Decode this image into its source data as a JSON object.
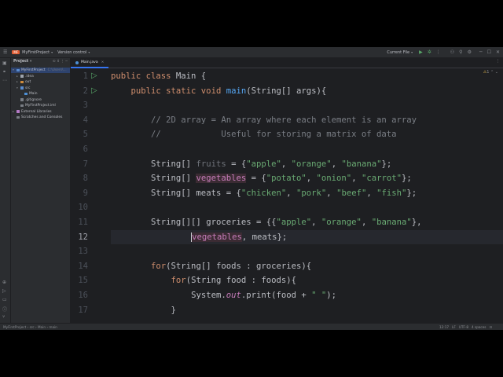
{
  "titlebar": {
    "project_badge": "MF",
    "project_name": "MyFirstProject",
    "vcs_label": "Version control",
    "run_config": "Current File"
  },
  "project_panel": {
    "title": "Project",
    "tree": [
      {
        "label": "MyFirstProject",
        "hint": "C:\\Users\\...",
        "level": 0,
        "icon": "folder-blue",
        "arrow": "▾"
      },
      {
        "label": ".idea",
        "level": 1,
        "icon": "folder",
        "arrow": "▸"
      },
      {
        "label": "out",
        "level": 1,
        "icon": "folder-orange",
        "arrow": "▸"
      },
      {
        "label": "src",
        "level": 1,
        "icon": "folder-blue",
        "arrow": "▾"
      },
      {
        "label": "Main",
        "level": 2,
        "icon": "java-file",
        "arrow": ""
      },
      {
        "label": ".gitignore",
        "level": 1,
        "icon": "file",
        "arrow": ""
      },
      {
        "label": "MyFirstProject.iml",
        "level": 1,
        "icon": "file",
        "arrow": ""
      },
      {
        "label": "External Libraries",
        "level": 0,
        "icon": "library",
        "arrow": "▸"
      },
      {
        "label": "Scratches and Consoles",
        "level": 0,
        "icon": "scratch",
        "arrow": ""
      }
    ]
  },
  "editor": {
    "tab_label": "Main.java",
    "warning_count": "1",
    "current_line": 12,
    "line_numbers": [
      "1",
      "2",
      "3",
      "4",
      "5",
      "6",
      "7",
      "8",
      "9",
      "10",
      "11",
      "12",
      "13",
      "14",
      "15",
      "16",
      "17"
    ],
    "code": {
      "l1_a": "public class ",
      "l1_b": "Main {",
      "l2_a": "public static void ",
      "l2_b": "main",
      "l2_c": "(String[] args){",
      "l4": "// 2D array = An array where each element is an array",
      "l5": "//            Useful for storing a matrix of data",
      "l7_a": "String[] ",
      "l7_b": "fruits",
      "l7_c": " = {",
      "l7_d": "\"apple\"",
      "l7_e": ", ",
      "l7_f": "\"orange\"",
      "l7_g": ", ",
      "l7_h": "\"banana\"",
      "l7_i": "};",
      "l8_a": "String[] ",
      "l8_b": "vegetables",
      "l8_c": " = {",
      "l8_d": "\"potato\"",
      "l8_e": ", ",
      "l8_f": "\"onion\"",
      "l8_g": ", ",
      "l8_h": "\"carrot\"",
      "l8_i": "};",
      "l9_a": "String[] meats = {",
      "l9_b": "\"chicken\"",
      "l9_c": ", ",
      "l9_d": "\"pork\"",
      "l9_e": ", ",
      "l9_f": "\"beef\"",
      "l9_g": ", ",
      "l9_h": "\"fish\"",
      "l9_i": "};",
      "l11_a": "String[][] groceries = {{",
      "l11_b": "\"apple\"",
      "l11_c": ", ",
      "l11_d": "\"orange\"",
      "l11_e": ", ",
      "l11_f": "\"banana\"",
      "l11_g": "},",
      "l12_a": "vegetables",
      "l12_b": ", meats};",
      "l14_a": "for",
      "l14_b": "(String[] foods : groceries){",
      "l15_a": "for",
      "l15_b": "(String food : foods){",
      "l16_a": "System.",
      "l16_b": "out",
      "l16_c": ".print(food + ",
      "l16_d": "\" \"",
      "l16_e": ");",
      "l17": "}"
    }
  },
  "status": {
    "breadcrumb": [
      "MyFirstProject",
      "src",
      "Main",
      "main"
    ],
    "position": "12:17",
    "line_ending": "LF",
    "encoding": "UTF-8",
    "indent": "4 spaces"
  },
  "colors": {
    "background": "#1e1f22",
    "panel": "#2b2d30",
    "keyword": "#cf8e6d",
    "string": "#6aab73",
    "function": "#56a8f5",
    "comment": "#7a7e85",
    "field": "#c77dbb",
    "run": "#59a869"
  }
}
